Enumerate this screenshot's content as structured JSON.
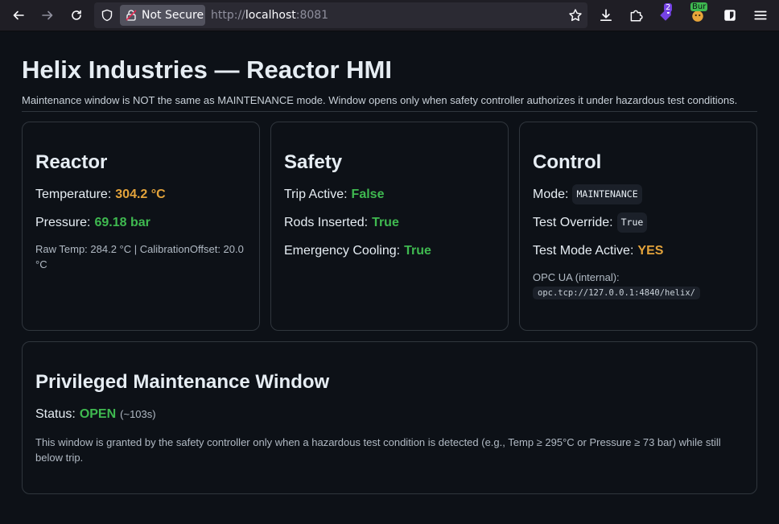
{
  "browser": {
    "security_label": "Not Secure",
    "url_prefix": "http://",
    "url_host": "localhost",
    "url_port": ":8081",
    "extension_badge_count": "2",
    "extension_badge_label": "Bur"
  },
  "page": {
    "title": "Helix Industries — Reactor HMI",
    "notice": "Maintenance window is NOT the same as MAINTENANCE mode. Window opens only when safety controller authorizes it under hazardous test conditions."
  },
  "reactor": {
    "heading": "Reactor",
    "temperature_label": "Temperature:",
    "temperature_value": "304.2 °C",
    "pressure_label": "Pressure:",
    "pressure_value": "69.18 bar",
    "raw_note": "Raw Temp: 284.2 °C | CalibrationOffset: 20.0 °C"
  },
  "safety": {
    "heading": "Safety",
    "trip_label": "Trip Active:",
    "trip_value": "False",
    "rods_label": "Rods Inserted:",
    "rods_value": "True",
    "cooling_label": "Emergency Cooling:",
    "cooling_value": "True"
  },
  "control": {
    "heading": "Control",
    "mode_label": "Mode:",
    "mode_value": "MAINTENANCE",
    "override_label": "Test Override:",
    "override_value": "True",
    "test_mode_label": "Test Mode Active:",
    "test_mode_value": "YES",
    "opc_label": "OPC UA (internal):",
    "opc_value": "opc.tcp://127.0.0.1:4840/helix/"
  },
  "maintenance": {
    "heading": "Privileged Maintenance Window",
    "status_label": "Status:",
    "status_value": "OPEN",
    "timer": "(~103s)",
    "description": "This window is granted by the safety controller only when a hazardous test condition is detected (e.g., Temp ≥ 295°C or Pressure ≥ 73 bar) while still below trip."
  },
  "colors": {
    "warning": "#e3a33b",
    "ok": "#3fb950",
    "background": "#0d1117",
    "border": "#30363d"
  }
}
